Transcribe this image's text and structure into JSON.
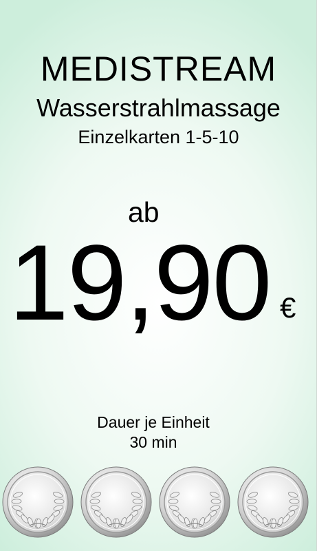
{
  "header": {
    "brand": "MEDISTREAM",
    "subtitle": "Wasserstrahlmassage",
    "subtitle2": "Einzelkarten 1-5-10"
  },
  "price": {
    "prefix": "ab",
    "amount": "19,90",
    "currency": "€"
  },
  "duration": {
    "label": "Dauer je Einheit",
    "value": "30 min"
  },
  "medals": [
    {
      "icon": "laurel-medal-icon"
    },
    {
      "icon": "laurel-medal-icon"
    },
    {
      "icon": "laurel-medal-icon"
    },
    {
      "icon": "laurel-medal-icon"
    }
  ],
  "colors": {
    "background_center": "#ffffff",
    "background_edge": "#cdeedc",
    "text": "#000000",
    "medal_silver": "#c9c9c9"
  }
}
